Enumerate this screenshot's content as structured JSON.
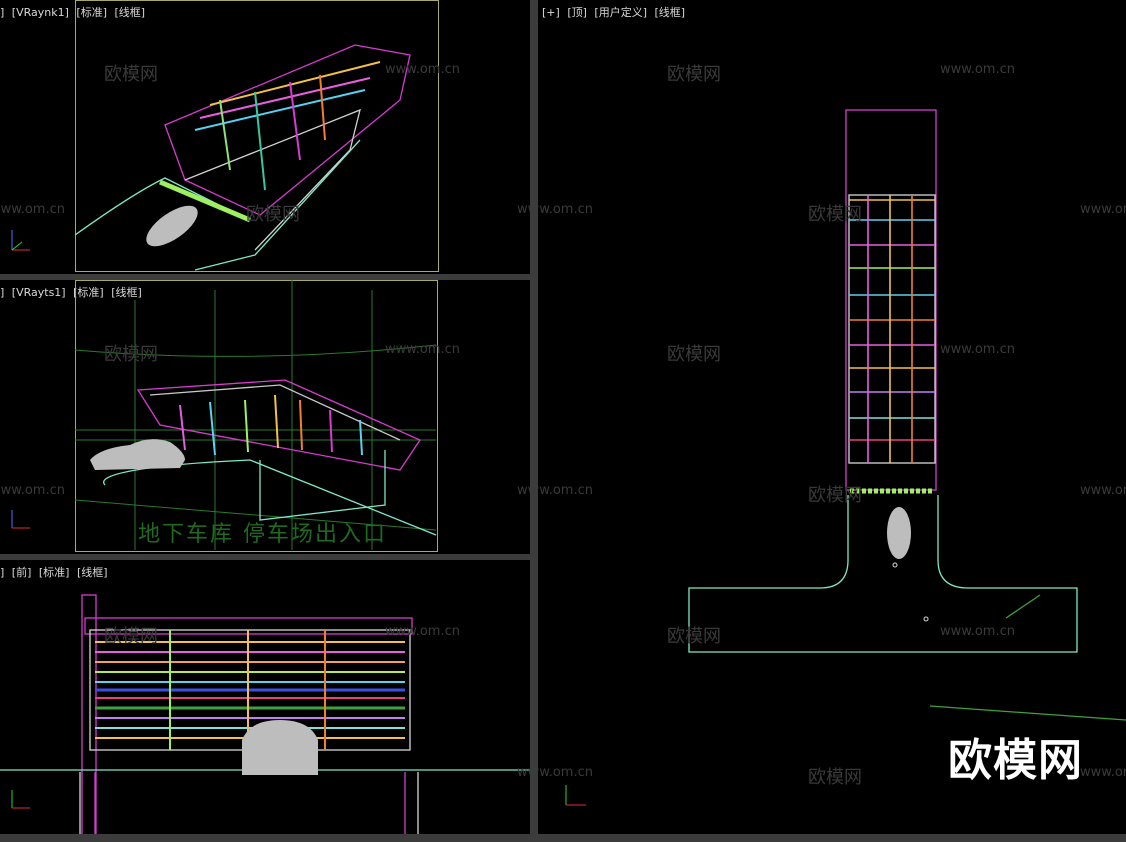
{
  "viewports": {
    "camera1": {
      "labels": [
        "]",
        "[VRaynk1]",
        "[标准]",
        "[线框]"
      ]
    },
    "camera2": {
      "labels": [
        "]",
        "[VRayts1]",
        "[标准]",
        "[线框]"
      ]
    },
    "front": {
      "labels": [
        "]",
        "[前]",
        "[标准]",
        "[线框]"
      ]
    },
    "top": {
      "labels": [
        "[+]",
        "[顶]",
        "[用户定义]",
        "[线框]"
      ]
    }
  },
  "scene_text": "地下车库 停车场出入口",
  "watermark": {
    "brand": "欧模网",
    "url": "www.om.cn"
  },
  "colors": {
    "background": "#000000",
    "divider": "#3c3c3c",
    "frame": "#a9a867",
    "magenta": "#d63ccf",
    "cyan": "#7fe8c9",
    "green": "#3fa23f"
  }
}
